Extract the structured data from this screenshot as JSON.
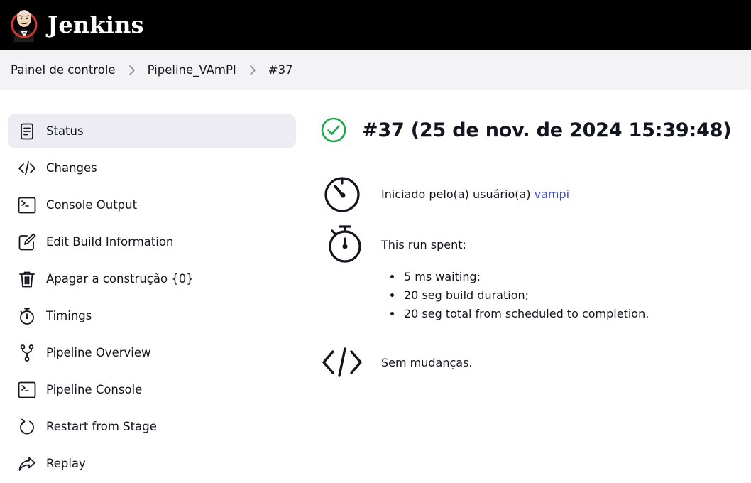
{
  "header": {
    "brand": "Jenkins"
  },
  "breadcrumb": [
    {
      "label": "Painel de controle"
    },
    {
      "label": "Pipeline_VAmPI"
    },
    {
      "label": "#37"
    }
  ],
  "sidebar": {
    "items": [
      {
        "label": "Status",
        "icon": "document-icon",
        "active": true
      },
      {
        "label": "Changes",
        "icon": "code-icon"
      },
      {
        "label": "Console Output",
        "icon": "terminal-icon"
      },
      {
        "label": "Edit Build Information",
        "icon": "edit-icon"
      },
      {
        "label": "Apagar a construção {0}",
        "icon": "trash-icon"
      },
      {
        "label": "Timings",
        "icon": "stopwatch-icon"
      },
      {
        "label": "Pipeline Overview",
        "icon": "branch-icon"
      },
      {
        "label": "Pipeline Console",
        "icon": "terminal-icon"
      },
      {
        "label": "Restart from Stage",
        "icon": "restart-icon"
      },
      {
        "label": "Replay",
        "icon": "replay-icon"
      }
    ]
  },
  "main": {
    "title": "#37 (25 de nov. de 2024 15:39:48)",
    "status": "success",
    "status_color": "#1ea64b",
    "started_by_prefix": "Iniciado pelo(a) usuário(a)",
    "started_by_user": "vampi",
    "run_spent_label": "This run spent:",
    "run_spent_items": [
      "5 ms waiting;",
      "20 seg build duration;",
      "20 seg total from scheduled to completion."
    ],
    "changes_text": "Sem mudanças."
  },
  "colors": {
    "header_bg": "#000000",
    "breadcrumb_bg": "#f3f3f6",
    "active_item_bg": "#ececf2",
    "link": "#3b4ad3",
    "success": "#1ea64b"
  }
}
